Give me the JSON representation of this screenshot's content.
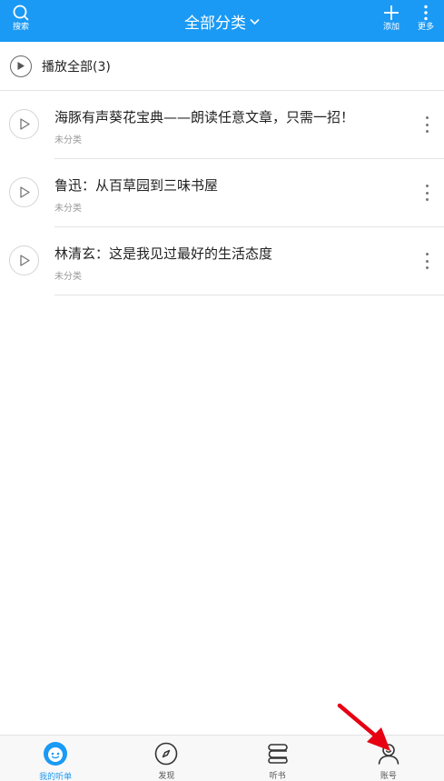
{
  "header": {
    "title": "全部分类",
    "search_label": "搜索",
    "add_label": "添加",
    "more_label": "更多",
    "bg_color": "#1a9af5"
  },
  "play_all": {
    "label": "播放全部(3)"
  },
  "tracks": [
    {
      "title": "海豚有声葵花宝典——朗读任意文章，只需一招！",
      "category": "未分类"
    },
    {
      "title": "鲁迅：从百草园到三味书屋",
      "category": "未分类"
    },
    {
      "title": "林清玄：这是我见过最好的生活态度",
      "category": "未分类"
    }
  ],
  "bottom_nav": {
    "tabs": [
      {
        "label": "我的听单",
        "icon": "smiley-icon",
        "active": true
      },
      {
        "label": "发现",
        "icon": "compass-icon",
        "active": false
      },
      {
        "label": "听书",
        "icon": "book-icon",
        "active": false
      },
      {
        "label": "账号",
        "icon": "user-icon",
        "active": false
      }
    ]
  },
  "annotation": {
    "arrow_color": "#e60012",
    "points_to": "账号"
  }
}
